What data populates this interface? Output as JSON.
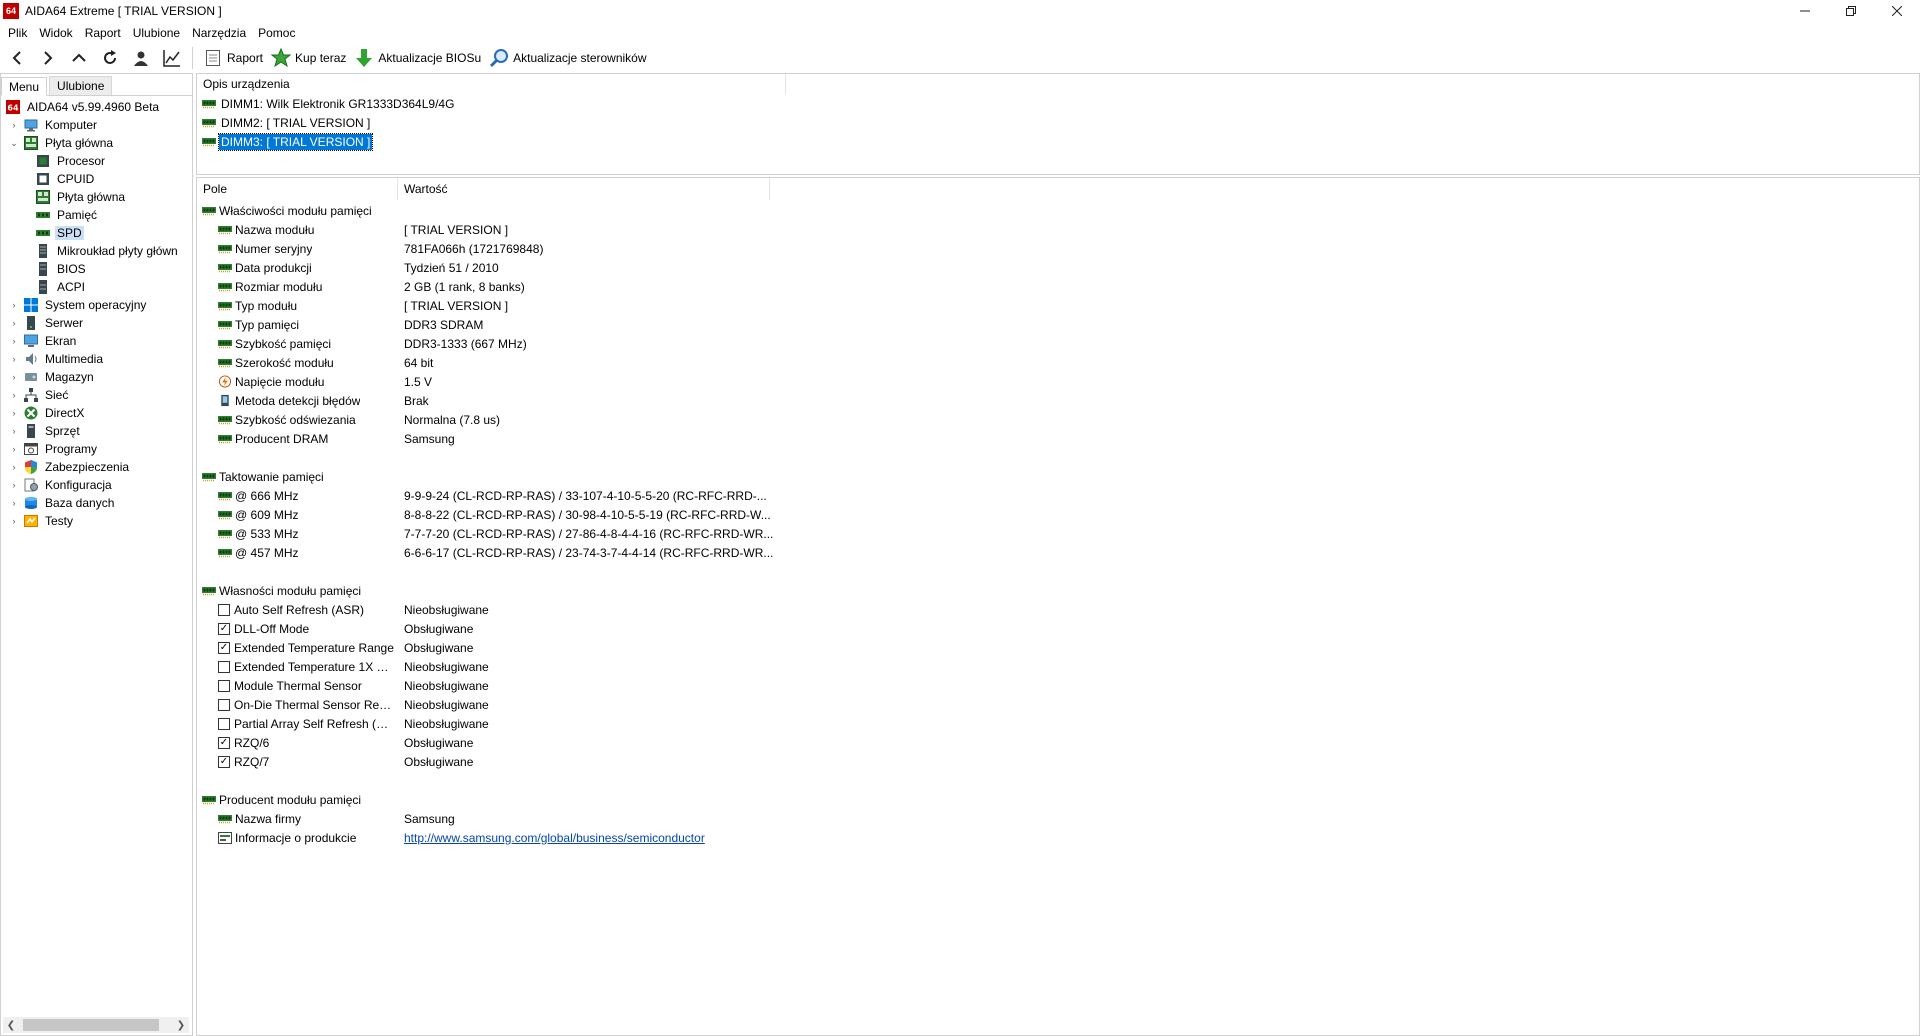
{
  "window": {
    "title": "AIDA64 Extreme  [ TRIAL VERSION ]",
    "logo_text": "64",
    "controls": [
      "minimize",
      "restore",
      "close"
    ]
  },
  "menu": [
    "Plik",
    "Widok",
    "Raport",
    "Ulubione",
    "Narzędzia",
    "Pomoc"
  ],
  "toolbar": {
    "nav_icons": [
      "back-arrow-icon",
      "forward-arrow-icon",
      "up-arrow-icon",
      "refresh-icon",
      "user-icon",
      "chart-icon"
    ],
    "buttons": [
      {
        "label": "Raport",
        "icon": "report-icon"
      },
      {
        "label": "Kup teraz",
        "icon": "buy-now-icon"
      },
      {
        "label": "Aktualizacje BIOSu",
        "icon": "bios-update-icon"
      },
      {
        "label": "Aktualizacje sterowników",
        "icon": "driver-update-icon"
      }
    ]
  },
  "left_panel": {
    "tabs": [
      "Menu",
      "Ulubione"
    ],
    "tree": [
      {
        "label": "AIDA64 v5.99.4960 Beta",
        "level": 0,
        "expander": "",
        "icon": "aida64-icon"
      },
      {
        "label": "Komputer",
        "level": 1,
        "expander": "closed",
        "icon": "computer-icon"
      },
      {
        "label": "Płyta główna",
        "level": 1,
        "expander": "open",
        "icon": "motherboard-icon"
      },
      {
        "label": "Procesor",
        "level": 2,
        "expander": "",
        "icon": "cpu-icon"
      },
      {
        "label": "CPUID",
        "level": 2,
        "expander": "",
        "icon": "cpuid-icon"
      },
      {
        "label": "Płyta główna",
        "level": 2,
        "expander": "",
        "icon": "motherboard-icon"
      },
      {
        "label": "Pamięć",
        "level": 2,
        "expander": "",
        "icon": "memory-icon"
      },
      {
        "label": "SPD",
        "level": 2,
        "expander": "",
        "icon": "memory-icon",
        "selected": true
      },
      {
        "label": "Mikroukład płyty główn",
        "level": 2,
        "expander": "",
        "icon": "chipset-icon"
      },
      {
        "label": "BIOS",
        "level": 2,
        "expander": "",
        "icon": "bios-icon"
      },
      {
        "label": "ACPI",
        "level": 2,
        "expander": "",
        "icon": "acpi-icon"
      },
      {
        "label": "System operacyjny",
        "level": 1,
        "expander": "closed",
        "icon": "windows-icon"
      },
      {
        "label": "Serwer",
        "level": 1,
        "expander": "closed",
        "icon": "server-icon"
      },
      {
        "label": "Ekran",
        "level": 1,
        "expander": "closed",
        "icon": "display-icon"
      },
      {
        "label": "Multimedia",
        "level": 1,
        "expander": "closed",
        "icon": "multimedia-icon"
      },
      {
        "label": "Magazyn",
        "level": 1,
        "expander": "closed",
        "icon": "storage-icon"
      },
      {
        "label": "Sieć",
        "level": 1,
        "expander": "closed",
        "icon": "network-icon"
      },
      {
        "label": "DirectX",
        "level": 1,
        "expander": "closed",
        "icon": "directx-icon"
      },
      {
        "label": "Sprzęt",
        "level": 1,
        "expander": "closed",
        "icon": "devices-icon"
      },
      {
        "label": "Programy",
        "level": 1,
        "expander": "closed",
        "icon": "software-icon"
      },
      {
        "label": "Zabezpieczenia",
        "level": 1,
        "expander": "closed",
        "icon": "security-icon"
      },
      {
        "label": "Konfiguracja",
        "level": 1,
        "expander": "closed",
        "icon": "config-icon"
      },
      {
        "label": "Baza danych",
        "level": 1,
        "expander": "closed",
        "icon": "database-icon"
      },
      {
        "label": "Testy",
        "level": 1,
        "expander": "closed",
        "icon": "benchmark-icon"
      }
    ]
  },
  "device_panel": {
    "header": "Opis urządzenia",
    "items": [
      {
        "label": "DIMM1: Wilk Elektronik GR1333D364L9/4G",
        "selected": false
      },
      {
        "label": "DIMM2: [ TRIAL VERSION ]",
        "selected": false
      },
      {
        "label": "DIMM3: [ TRIAL VERSION ]",
        "selected": true
      }
    ]
  },
  "details": {
    "headers": {
      "field": "Pole",
      "value": "Wartość"
    },
    "sections": [
      {
        "title": "Właściwości modułu pamięci",
        "rows": [
          {
            "field": "Nazwa modułu",
            "value": "[ TRIAL VERSION ]",
            "icon": "ram"
          },
          {
            "field": "Numer seryjny",
            "value": "781FA066h (1721769848)",
            "icon": "ram"
          },
          {
            "field": "Data produkcji",
            "value": "Tydzień 51 / 2010",
            "icon": "ram"
          },
          {
            "field": "Rozmiar modułu",
            "value": "2 GB (1 rank, 8 banks)",
            "icon": "ram"
          },
          {
            "field": "Typ modułu",
            "value": "[ TRIAL VERSION ]",
            "icon": "ram"
          },
          {
            "field": "Typ pamięci",
            "value": "DDR3 SDRAM",
            "icon": "ram"
          },
          {
            "field": "Szybkość pamięci",
            "value": "DDR3-1333 (667 MHz)",
            "icon": "ram"
          },
          {
            "field": "Szerokość modułu",
            "value": "64 bit",
            "icon": "ram"
          },
          {
            "field": "Napięcie modułu",
            "value": "1.5 V",
            "icon": "voltage"
          },
          {
            "field": "Metoda detekcji błędów",
            "value": "Brak",
            "icon": "device"
          },
          {
            "field": "Szybkość odświezania",
            "value": "Normalna (7.8 us)",
            "icon": "ram"
          },
          {
            "field": "Producent DRAM",
            "value": "Samsung",
            "icon": "ram"
          }
        ]
      },
      {
        "title": "Taktowanie pamięci",
        "rows": [
          {
            "field": "@ 666 MHz",
            "value": "9-9-9-24  (CL-RCD-RP-RAS) / 33-107-4-10-5-5-20  (RC-RFC-RRD-...",
            "icon": "ram"
          },
          {
            "field": "@ 609 MHz",
            "value": "8-8-8-22  (CL-RCD-RP-RAS) / 30-98-4-10-5-5-19  (RC-RFC-RRD-W...",
            "icon": "ram"
          },
          {
            "field": "@ 533 MHz",
            "value": "7-7-7-20  (CL-RCD-RP-RAS) / 27-86-4-8-4-4-16  (RC-RFC-RRD-WR...",
            "icon": "ram"
          },
          {
            "field": "@ 457 MHz",
            "value": "6-6-6-17  (CL-RCD-RP-RAS) / 23-74-3-7-4-4-14  (RC-RFC-RRD-WR...",
            "icon": "ram"
          }
        ]
      },
      {
        "title": "Własności modułu pamięci",
        "rows": [
          {
            "field": "Auto Self Refresh (ASR)",
            "value": "Nieobsługiwane",
            "checked": false
          },
          {
            "field": "DLL-Off Mode",
            "value": "Obsługiwane",
            "checked": true
          },
          {
            "field": "Extended Temperature Range",
            "value": "Obsługiwane",
            "checked": true
          },
          {
            "field": "Extended Temperature 1X Re...",
            "value": "Nieobsługiwane",
            "checked": false
          },
          {
            "field": "Module Thermal Sensor",
            "value": "Nieobsługiwane",
            "checked": false
          },
          {
            "field": "On-Die Thermal Sensor Rea...",
            "value": "Nieobsługiwane",
            "checked": false
          },
          {
            "field": "Partial Array Self Refresh (PA...",
            "value": "Nieobsługiwane",
            "checked": false
          },
          {
            "field": "RZQ/6",
            "value": "Obsługiwane",
            "checked": true
          },
          {
            "field": "RZQ/7",
            "value": "Obsługiwane",
            "checked": true
          }
        ]
      },
      {
        "title": "Producent modułu pamięci",
        "rows": [
          {
            "field": "Nazwa firmy",
            "value": "Samsung",
            "icon": "ram"
          },
          {
            "field": "Informacje o produkcie",
            "value": "http://www.samsung.com/global/business/semiconductor",
            "icon": "link",
            "is_link": true
          }
        ]
      }
    ]
  },
  "colors": {
    "selection": "#0078d7",
    "tree_selection": "#cce0f5",
    "link": "#0645ad",
    "ram_green": "#2e7d32"
  }
}
